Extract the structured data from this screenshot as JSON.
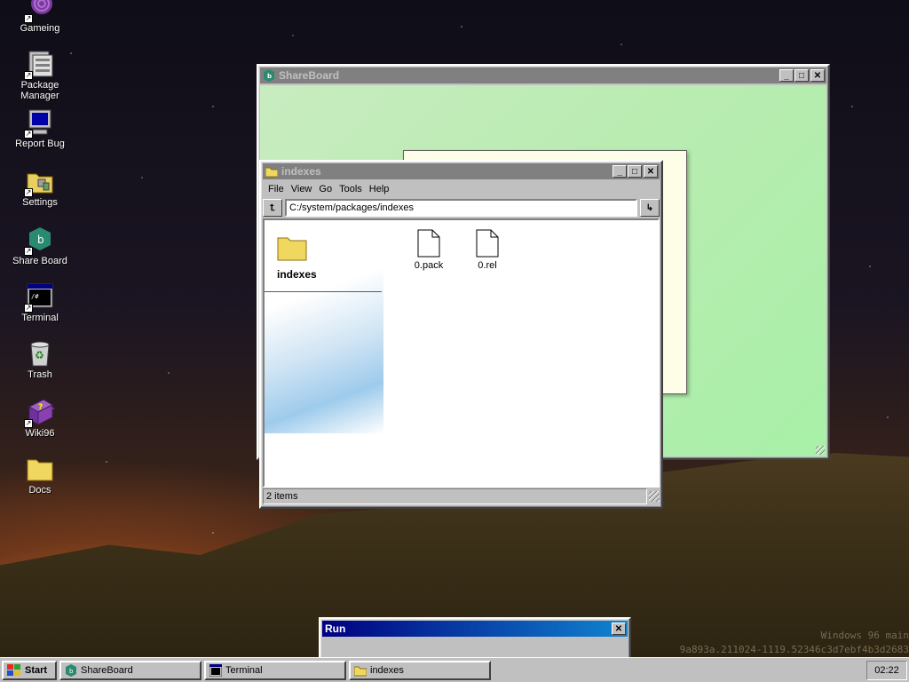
{
  "desktop": {
    "icons": [
      {
        "label": "Gameing"
      },
      {
        "label": "Package Manager"
      },
      {
        "label": "Report Bug"
      },
      {
        "label": "Settings"
      },
      {
        "label": "Share Board"
      },
      {
        "label": "Terminal"
      },
      {
        "label": "Trash"
      },
      {
        "label": "Wiki96"
      },
      {
        "label": "Docs"
      }
    ],
    "watermark_line1": "Windows 96 main",
    "watermark_line2": "9a893a.211024-1119.52346c3d7ebf4b3d2683"
  },
  "shareboard_window": {
    "title": "ShareBoard",
    "colors": {
      "canvas_from": "#c8ecc0",
      "canvas_to": "#a8f0a8"
    }
  },
  "explorer_window": {
    "title": "indexes",
    "menu": [
      "File",
      "View",
      "Go",
      "Tools",
      "Help"
    ],
    "address": "C:/system/packages/indexes",
    "sidebar_folder": "indexes",
    "files": [
      {
        "name": "0.pack"
      },
      {
        "name": "0.rel"
      }
    ],
    "status": "2 items"
  },
  "run_dialog": {
    "title": "Run"
  },
  "taskbar": {
    "start_label": "Start",
    "tasks": [
      {
        "label": "ShareBoard"
      },
      {
        "label": "Terminal"
      },
      {
        "label": "indexes"
      }
    ],
    "clock": "02:22"
  }
}
